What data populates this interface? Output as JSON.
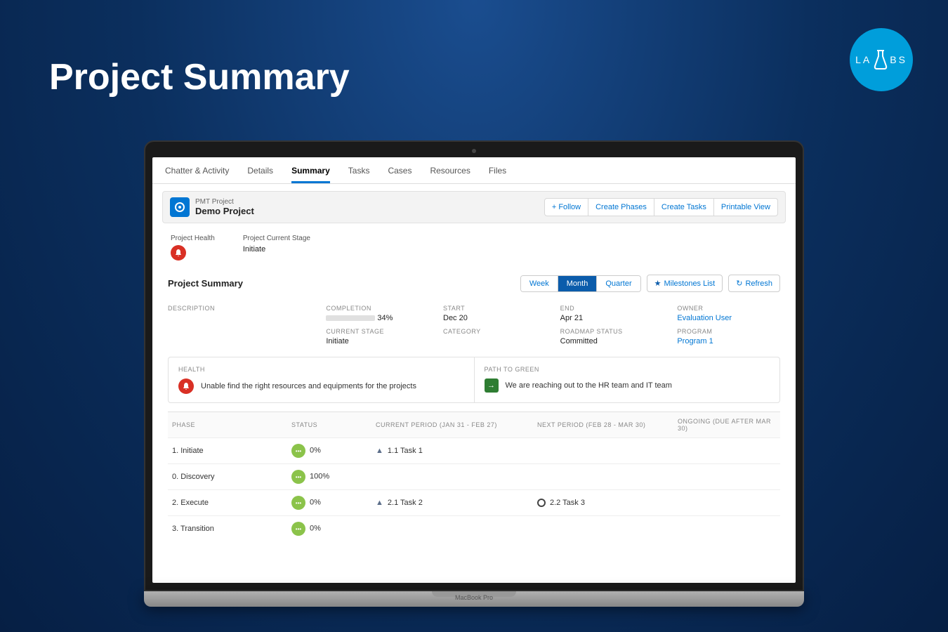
{
  "slide": {
    "title": "Project Summary",
    "labs": "L A B S"
  },
  "laptop": {
    "model": "MacBook Pro"
  },
  "tabs": [
    {
      "label": "Chatter & Activity"
    },
    {
      "label": "Details"
    },
    {
      "label": "Summary",
      "active": true
    },
    {
      "label": "Tasks"
    },
    {
      "label": "Cases"
    },
    {
      "label": "Resources"
    },
    {
      "label": "Files"
    }
  ],
  "record": {
    "type": "PMT Project",
    "name": "Demo Project",
    "actions": {
      "follow": "Follow",
      "create_phases": "Create Phases",
      "create_tasks": "Create Tasks",
      "printable": "Printable View"
    }
  },
  "subfields": {
    "health_label": "Project Health",
    "stage_label": "Project Current Stage",
    "stage_value": "Initiate"
  },
  "summary": {
    "title": "Project Summary",
    "ranges": {
      "week": "Week",
      "month": "Month",
      "quarter": "Quarter"
    },
    "milestones": "Milestones List",
    "refresh": "Refresh"
  },
  "meta": {
    "description_label": "DESCRIPTION",
    "completion_label": "COMPLETION",
    "completion_pct": "34%",
    "completion_value": 34,
    "start_label": "START",
    "start_value": "Dec 20",
    "end_label": "END",
    "end_value": "Apr 21",
    "owner_label": "OWNER",
    "owner_value": "Evaluation User",
    "current_stage_label": "CURRENT STAGE",
    "current_stage_value": "Initiate",
    "category_label": "CATEGORY",
    "category_value": "",
    "roadmap_label": "ROADMAP STATUS",
    "roadmap_value": "Committed",
    "program_label": "PROGRAM",
    "program_value": "Program 1"
  },
  "boxes": {
    "health_label": "HEALTH",
    "health_text": "Unable find the right resources and equipments for the projects",
    "path_label": "PATH TO GREEN",
    "path_text": "We are reaching out to the HR team and IT team"
  },
  "phase_headers": {
    "phase": "PHASE",
    "status": "STATUS",
    "current": "CURRENT PERIOD (JAN 31 - FEB 27)",
    "next": "NEXT PERIOD (FEB 28 - MAR 30)",
    "ongoing": "ONGOING (DUE AFTER MAR 30)"
  },
  "phases": [
    {
      "name": "1. Initiate",
      "pct": "0%",
      "current_task": "1.1 Task 1",
      "next_task": ""
    },
    {
      "name": "0. Discovery",
      "pct": "100%",
      "current_task": "",
      "next_task": ""
    },
    {
      "name": "2. Execute",
      "pct": "0%",
      "current_task": "2.1 Task 2",
      "next_task": "2.2 Task 3"
    },
    {
      "name": "3. Transition",
      "pct": "0%",
      "current_task": "",
      "next_task": ""
    }
  ]
}
